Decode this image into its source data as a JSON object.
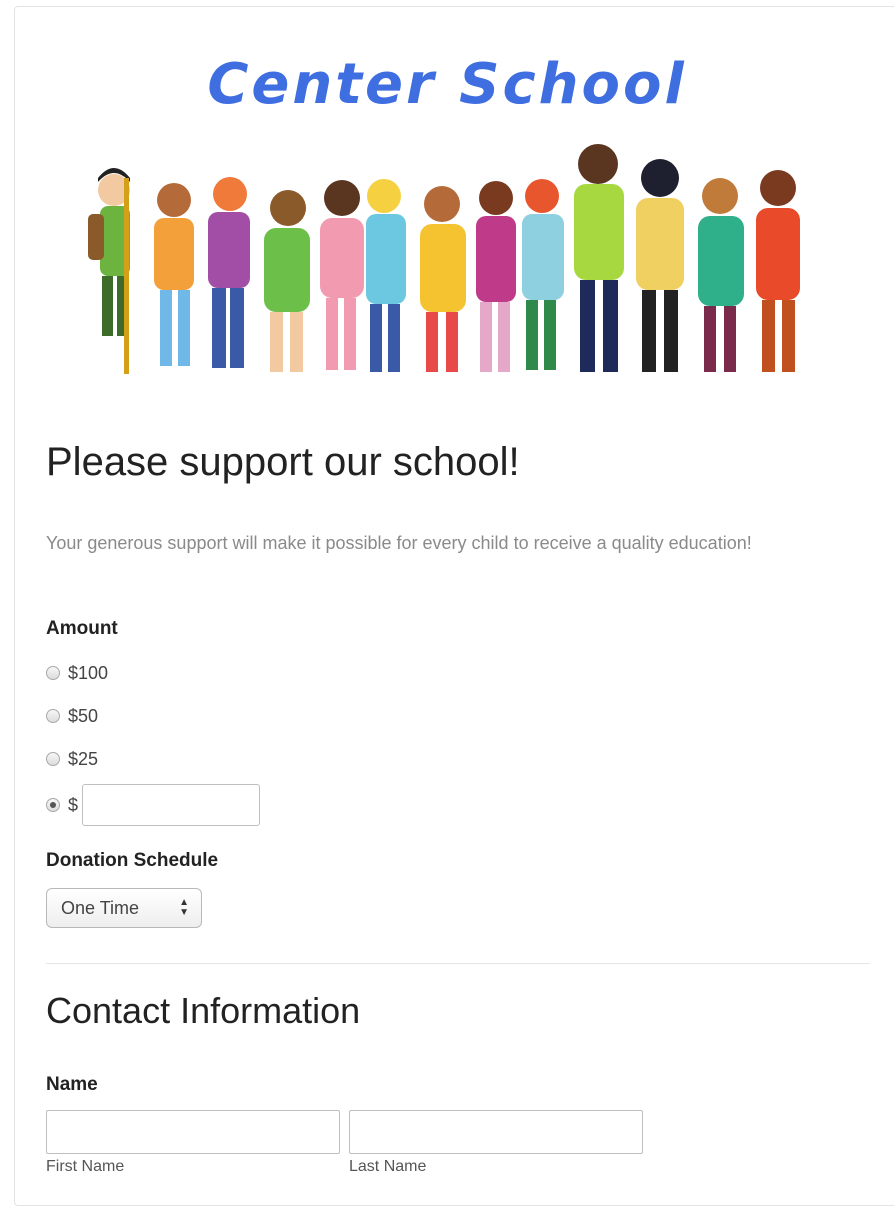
{
  "header": {
    "logo_text": "Center School"
  },
  "main": {
    "title": "Please support our school!",
    "intro": "Your generous support will make it possible for every child to receive a quality education!"
  },
  "amount": {
    "label": "Amount",
    "options": [
      "$100",
      "$50",
      "$25",
      "$"
    ],
    "selected_index": 3,
    "custom_value": ""
  },
  "schedule": {
    "label": "Donation Schedule",
    "selected": "One Time"
  },
  "contact": {
    "heading": "Contact Information",
    "name_label": "Name",
    "first_name_label": "First Name",
    "last_name_label": "Last Name",
    "first_name_value": "",
    "last_name_value": ""
  },
  "colors": {
    "logo": "#3f6ee0",
    "text_dark": "#222222",
    "text_muted": "#8a8a8a",
    "border": "#bfbfbf"
  }
}
